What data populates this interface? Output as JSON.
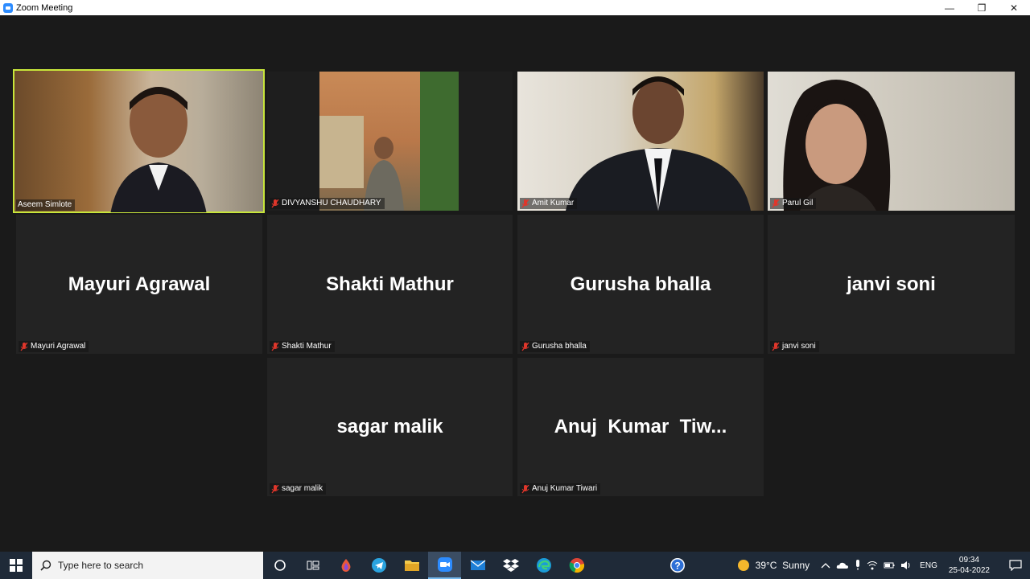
{
  "window": {
    "title": "Zoom Meeting",
    "minimize": "—",
    "restore": "❐",
    "close": "✕"
  },
  "participants": [
    {
      "name": "Aseem Simlote",
      "label": "Aseem Simlote",
      "video": true,
      "active_speaker": true,
      "muted": false
    },
    {
      "name": "DIVYANSHU CHAUDHARY",
      "label": "DIVYANSHU CHAUDHARY",
      "video": true,
      "muted": true
    },
    {
      "name": "Amit Kumar",
      "label": "Amit Kumar",
      "video": true,
      "muted": true
    },
    {
      "name": "Parul Gil",
      "label": "Parul Gil",
      "video": true,
      "muted": true
    },
    {
      "name": "Mayuri Agrawal",
      "label": "Mayuri Agrawal",
      "video": false,
      "muted": true
    },
    {
      "name": "Shakti Mathur",
      "label": "Shakti Mathur",
      "video": false,
      "muted": true
    },
    {
      "name": "Gurusha bhalla",
      "label": "Gurusha bhalla",
      "video": false,
      "muted": true
    },
    {
      "name": "janvi soni",
      "label": "janvi soni",
      "video": false,
      "muted": true
    },
    {
      "name": "sagar malik",
      "label": "sagar malik",
      "video": false,
      "muted": true
    },
    {
      "name": "Anuj  Kumar  Tiw...",
      "label": "Anuj Kumar Tiwari",
      "video": false,
      "muted": true
    }
  ],
  "taskbar": {
    "search_placeholder": "Type here to search",
    "apps": [
      "task-view",
      "edge-drop",
      "telegram",
      "file-explorer",
      "zoom",
      "mail",
      "dropbox",
      "edge",
      "chrome",
      "help"
    ],
    "weather": "39°C  Sunny",
    "language": "ENG",
    "time": "09:34",
    "date": "25-04-2022"
  },
  "colors": {
    "background": "#1a1a1a",
    "tile": "#232323",
    "active_outline": "#c8e63a",
    "mute_red": "#e0362b",
    "taskbar": "#1f2a38"
  }
}
